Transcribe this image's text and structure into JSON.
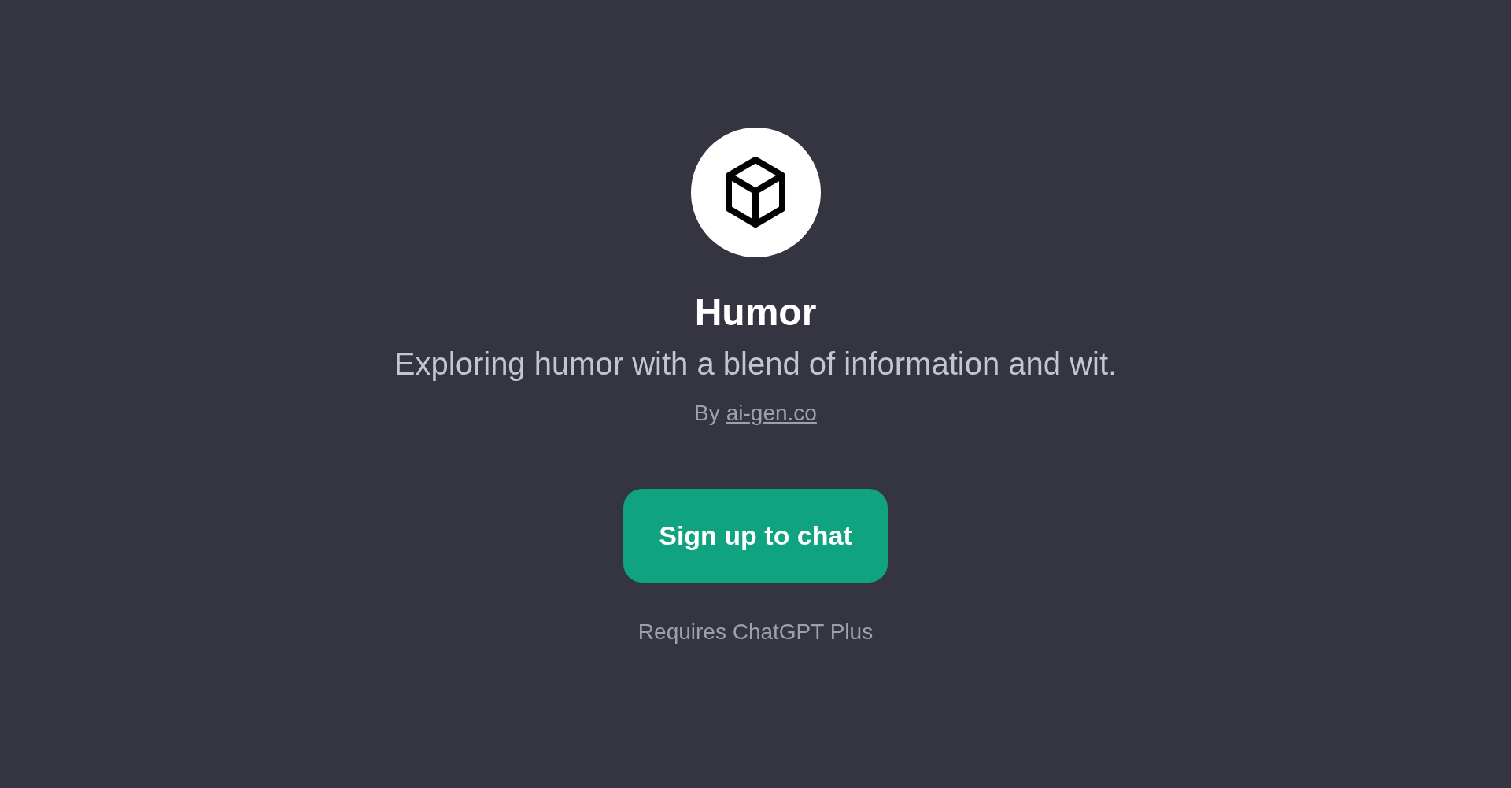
{
  "gpt": {
    "name": "Humor",
    "description": "Exploring humor with a blend of information and wit.",
    "by_prefix": "By",
    "author_link": "ai-gen.co"
  },
  "signup_button": "Sign up to chat",
  "requirement_note": "Requires ChatGPT Plus"
}
